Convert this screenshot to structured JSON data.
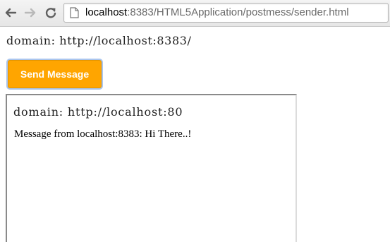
{
  "browser": {
    "url_host": "localhost",
    "url_rest": ":8383/HTML5Application/postmess/sender.html",
    "icons": {
      "back": "arrow-left-icon",
      "forward": "arrow-right-icon",
      "reload": "reload-icon",
      "page": "page-icon"
    }
  },
  "page": {
    "domain_text": "domain: http://localhost:8383/",
    "send_button_label": "Send Message",
    "button_color": "#ffa500"
  },
  "iframe": {
    "domain_text": "domain: http://localhost:80",
    "message_text": "Message from localhost:8383: Hi There..!"
  }
}
